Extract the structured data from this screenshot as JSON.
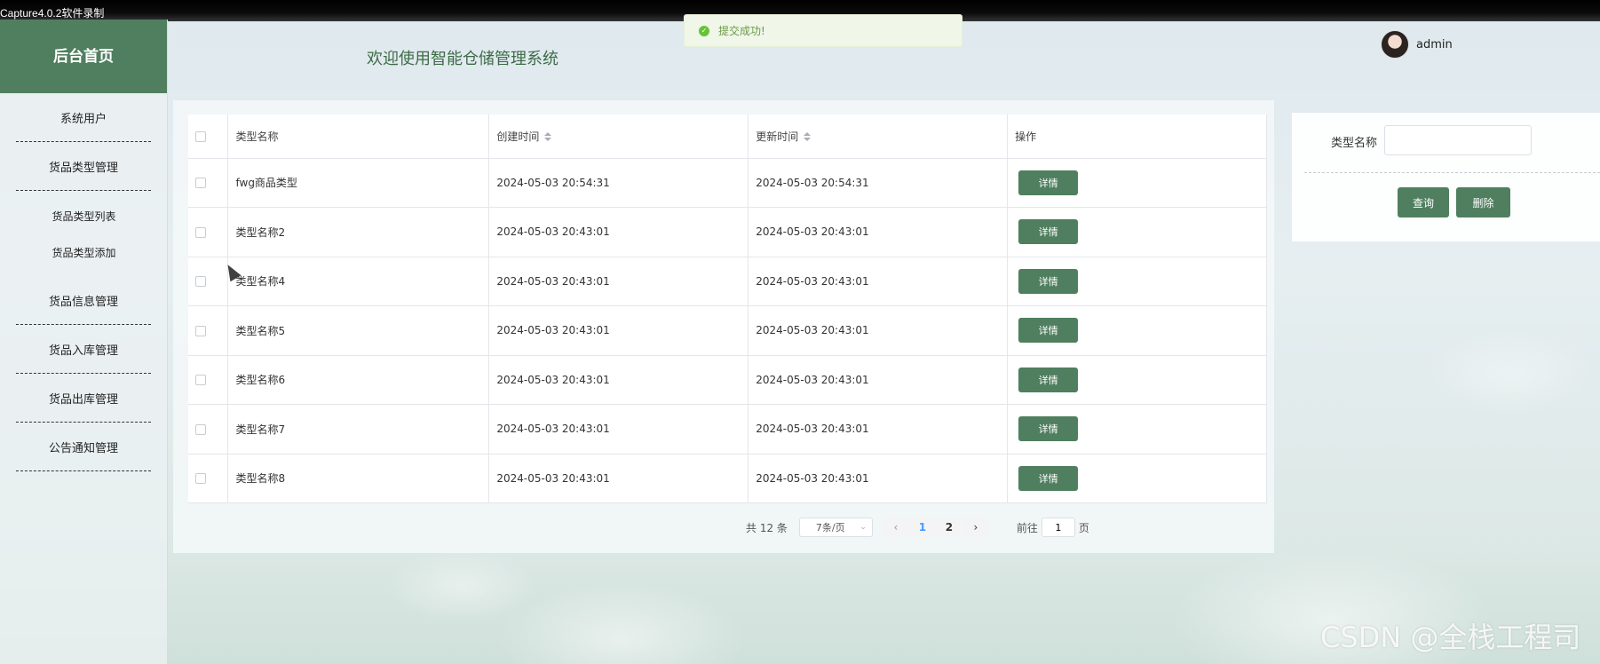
{
  "recorder": {
    "caption": "Capture4.0.2软件录制"
  },
  "sidebar": {
    "brand": "后台首页",
    "items": [
      {
        "label": "系统用户"
      },
      {
        "label": "货品类型管理",
        "children": [
          {
            "label": "货品类型列表"
          },
          {
            "label": "货品类型添加"
          }
        ]
      },
      {
        "label": "货品信息管理"
      },
      {
        "label": "货品入库管理"
      },
      {
        "label": "货品出库管理"
      },
      {
        "label": "公告通知管理"
      }
    ]
  },
  "header": {
    "title": "欢迎使用智能仓储管理系统",
    "toast": "提交成功!",
    "user": "admin"
  },
  "table": {
    "columns": [
      "类型名称",
      "创建时间",
      "更新时间",
      "操作"
    ],
    "action_label": "详情",
    "rows": [
      {
        "name": "fwg商品类型",
        "created": "2024-05-03 20:54:31",
        "updated": "2024-05-03 20:54:31"
      },
      {
        "name": "类型名称2",
        "created": "2024-05-03 20:43:01",
        "updated": "2024-05-03 20:43:01"
      },
      {
        "name": "类型名称4",
        "created": "2024-05-03 20:43:01",
        "updated": "2024-05-03 20:43:01"
      },
      {
        "name": "类型名称5",
        "created": "2024-05-03 20:43:01",
        "updated": "2024-05-03 20:43:01"
      },
      {
        "name": "类型名称6",
        "created": "2024-05-03 20:43:01",
        "updated": "2024-05-03 20:43:01"
      },
      {
        "name": "类型名称7",
        "created": "2024-05-03 20:43:01",
        "updated": "2024-05-03 20:43:01"
      },
      {
        "name": "类型名称8",
        "created": "2024-05-03 20:43:01",
        "updated": "2024-05-03 20:43:01"
      }
    ]
  },
  "pagination": {
    "total": "共 12 条",
    "page_size": "7条/页",
    "pages": [
      "1",
      "2"
    ],
    "current": "1",
    "goto_label": "前往",
    "goto_value": "1",
    "page_suffix": "页"
  },
  "search": {
    "label": "类型名称",
    "value": "",
    "query_button": "查询",
    "delete_button": "删除"
  },
  "watermark": "CSDN @全栈工程司",
  "colors": {
    "primary": "#4f7f5f",
    "title": "#3d6b47",
    "page_active": "#409eff",
    "toast_text": "#6a9a46"
  }
}
